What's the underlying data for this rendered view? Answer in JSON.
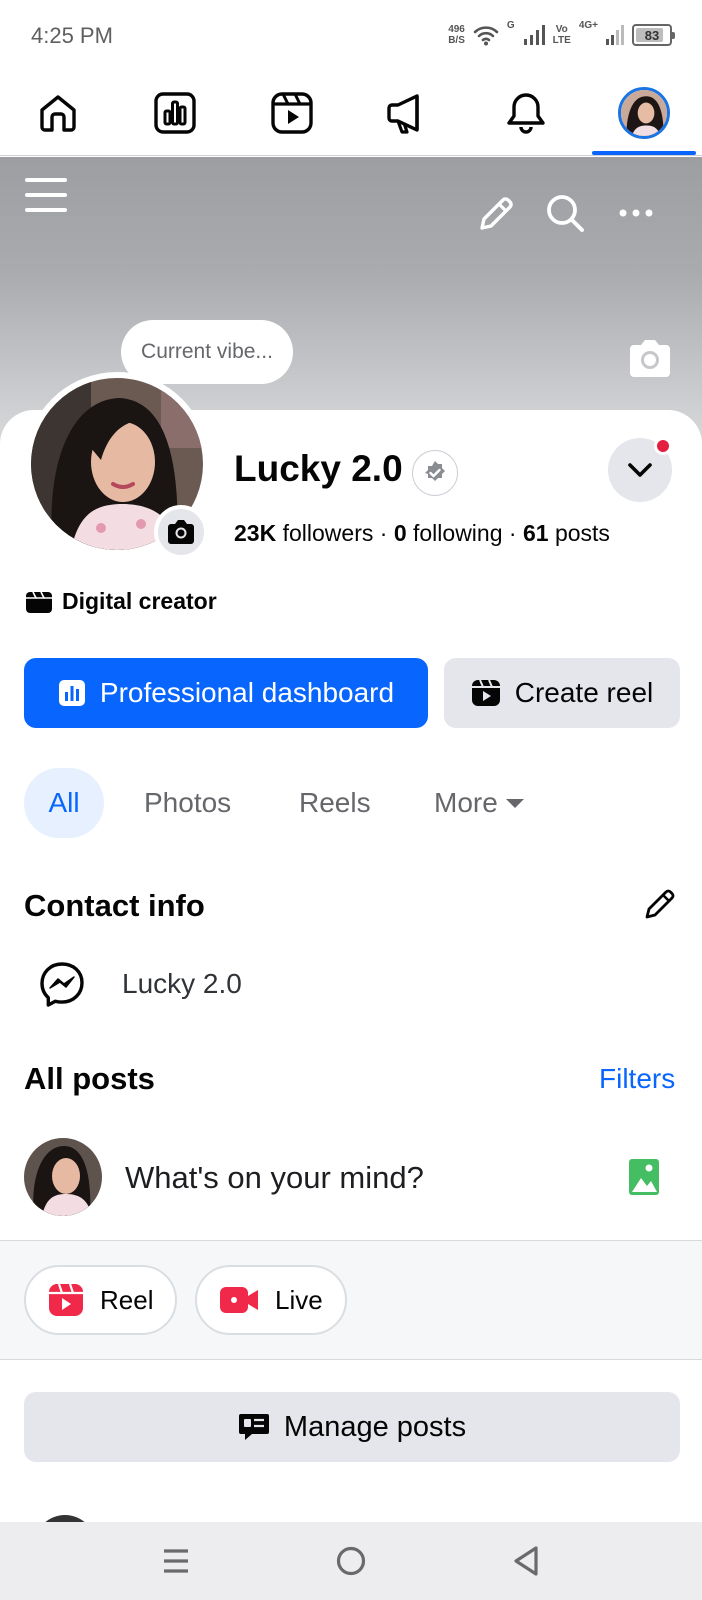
{
  "status_bar": {
    "time": "4:25 PM",
    "net_speed_value": "496",
    "net_speed_unit": "B/S",
    "signal_label": "G",
    "volte_top": "Vo",
    "volte_bottom": "LTE",
    "network_4g": "4G+",
    "battery_level": "83",
    "battery_fraction": 0.83
  },
  "top_nav": {
    "items": [
      "home-icon",
      "dashboard-icon",
      "reels-icon",
      "megaphone-icon",
      "bell-icon",
      "profile-avatar"
    ],
    "active_index": 5
  },
  "cover": {
    "status_bubble": "Current vibe..."
  },
  "profile": {
    "name": "Lucky 2.0",
    "followers_count": "23K",
    "followers_label": "followers",
    "following_count": "0",
    "following_label": "following",
    "posts_count": "61",
    "posts_label": "posts",
    "separator": "·",
    "category": "Digital creator"
  },
  "actions": {
    "primary": "Professional dashboard",
    "secondary": "Create reel"
  },
  "tabs": [
    "All",
    "Photos",
    "Reels",
    "More"
  ],
  "contact_info": {
    "title": "Contact info",
    "messenger_name": "Lucky 2.0"
  },
  "posts": {
    "title": "All posts",
    "filters": "Filters",
    "composer_placeholder": "What's on your mind?",
    "chips": [
      "Reel",
      "Live"
    ],
    "manage": "Manage posts"
  },
  "colors": {
    "brand_blue": "#0866ff",
    "button_gray": "#e4e6eb",
    "notification_red": "#e41e3f",
    "reel_red": "#f02849",
    "photo_green": "#45bd62"
  }
}
